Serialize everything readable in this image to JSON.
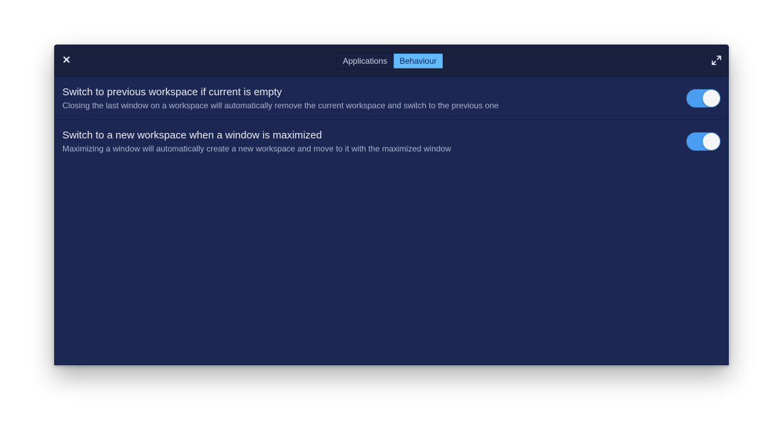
{
  "window": {
    "tabs": [
      {
        "label": "Applications",
        "active": false
      },
      {
        "label": "Behaviour",
        "active": true
      }
    ],
    "icons": {
      "close": "close-icon",
      "maximize": "maximize-icon"
    }
  },
  "settings": [
    {
      "title": "Switch to previous workspace if current is empty",
      "description": "Closing the last window on a workspace will automatically remove the current workspace and switch to the previous one",
      "enabled": true
    },
    {
      "title": "Switch to a new workspace when a window is maximized",
      "description": "Maximizing a window will automatically create a new workspace and move to it with the maximized window",
      "enabled": true
    }
  ],
  "colors": {
    "accent": "#64baff",
    "switch_on": "#4a9df0",
    "window_bg": "#1c2754",
    "titlebar_bg": "#1a213f"
  }
}
